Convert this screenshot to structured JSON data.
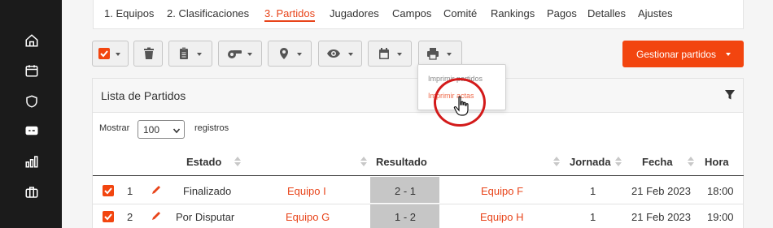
{
  "tabs": [
    {
      "label": "1. Equipos",
      "active": false
    },
    {
      "label": "2. Clasificaciones",
      "active": false
    },
    {
      "label": "3. Partidos",
      "active": true
    },
    {
      "label": "Jugadores",
      "active": false
    },
    {
      "label": "Campos",
      "active": false
    },
    {
      "label": "Comité",
      "active": false
    },
    {
      "label": "Rankings",
      "active": false
    },
    {
      "label": "Pagos",
      "active": false
    },
    {
      "label": "Detalles",
      "active": false
    },
    {
      "label": "Ajustes",
      "active": false
    }
  ],
  "sidebar": {
    "icons": [
      "home-icon",
      "calendar-icon",
      "shield-icon",
      "ticket-icon",
      "bar-chart-icon",
      "briefcase-icon"
    ]
  },
  "toolbar": {
    "buttons": [
      "checkbox-select-icon",
      "trash-icon",
      "clipboard-icon",
      "whistle-icon",
      "map-pin-icon",
      "eye-icon",
      "calendar-icon",
      "print-icon"
    ],
    "manage_label": "Gestionar partidos"
  },
  "print_menu": {
    "items": [
      "Imprimir partidos",
      "Imprimir actas"
    ]
  },
  "panel": {
    "title": "Lista de Partidos"
  },
  "length_control": {
    "show_label": "Mostrar",
    "value": "100",
    "records_label": "registros"
  },
  "table": {
    "columns": [
      "Estado",
      "Resultado",
      "Jornada",
      "Fecha",
      "Hora"
    ],
    "rows": [
      {
        "num": "1",
        "estado": "Finalizado",
        "home": "Equipo I",
        "result": "2 - 1",
        "away": "Equipo F",
        "jornada": "1",
        "fecha": "21 Feb 2023",
        "hora": "18:00"
      },
      {
        "num": "2",
        "estado": "Por Disputar",
        "home": "Equipo G",
        "result": "1 - 2",
        "away": "Equipo H",
        "jornada": "1",
        "fecha": "21 Feb 2023",
        "hora": "19:00"
      }
    ]
  },
  "colors": {
    "accent": "#f2450f",
    "sidebar": "#1b1b1b",
    "highlight": "#d31a1a"
  }
}
